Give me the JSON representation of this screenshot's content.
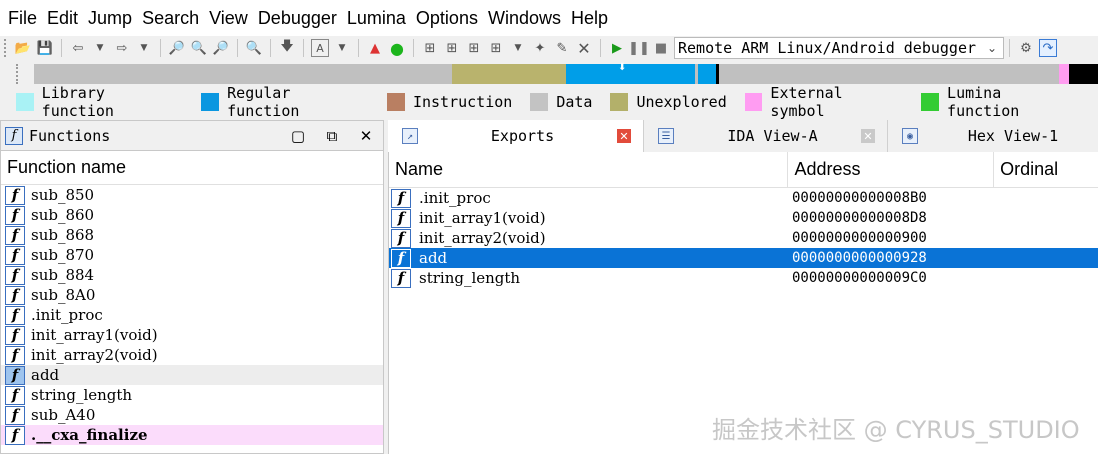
{
  "menu": [
    "File",
    "Edit",
    "Jump",
    "Search",
    "View",
    "Debugger",
    "Lumina",
    "Options",
    "Windows",
    "Help"
  ],
  "toolbar": {
    "debugger_select": "Remote ARM Linux/Android debugger"
  },
  "navigation_band": {
    "colors": {
      "data": "#c0c0c0",
      "unexplored": "#b9b36d",
      "regular": "#009ee8",
      "external": "#ff9df0",
      "end": "#000000"
    }
  },
  "legend": [
    {
      "label": "Library function",
      "color": "#a9f2f5"
    },
    {
      "label": "Regular function",
      "color": "#0b97e0"
    },
    {
      "label": "Instruction",
      "color": "#b97f62"
    },
    {
      "label": "Data",
      "color": "#c3c3c3"
    },
    {
      "label": "Unexplored",
      "color": "#b3b06a"
    },
    {
      "label": "External symbol",
      "color": "#ff9cf2"
    },
    {
      "label": "Lumina function",
      "color": "#33cc33"
    }
  ],
  "functions_panel": {
    "title": "Functions",
    "column": "Function name",
    "items": [
      {
        "name": "sub_850",
        "state": "normal"
      },
      {
        "name": "sub_860",
        "state": "normal"
      },
      {
        "name": "sub_868",
        "state": "normal"
      },
      {
        "name": "sub_870",
        "state": "normal"
      },
      {
        "name": "sub_884",
        "state": "normal"
      },
      {
        "name": "sub_8A0",
        "state": "normal"
      },
      {
        "name": ".init_proc",
        "state": "normal"
      },
      {
        "name": "init_array1(void)",
        "state": "normal"
      },
      {
        "name": "init_array2(void)",
        "state": "normal"
      },
      {
        "name": "add",
        "state": "selected"
      },
      {
        "name": "string_length",
        "state": "normal"
      },
      {
        "name": "sub_A40",
        "state": "normal"
      },
      {
        "name": ".__cxa_finalize",
        "state": "external"
      }
    ]
  },
  "tabs": [
    {
      "label": "Exports",
      "active": true
    },
    {
      "label": "IDA View-A",
      "active": false
    },
    {
      "label": "Hex View-1",
      "active": false
    }
  ],
  "exports": {
    "columns": [
      "Name",
      "Address",
      "Ordinal"
    ],
    "rows": [
      {
        "name": ".init_proc",
        "address": "00000000000008B0",
        "selected": false
      },
      {
        "name": "init_array1(void)",
        "address": "00000000000008D8",
        "selected": false
      },
      {
        "name": "init_array2(void)",
        "address": "0000000000000900",
        "selected": false
      },
      {
        "name": "add",
        "address": "0000000000000928",
        "selected": true
      },
      {
        "name": "string_length",
        "address": "00000000000009C0",
        "selected": false
      }
    ]
  },
  "watermark": "掘金技术社区 @ CYRUS_STUDIO"
}
